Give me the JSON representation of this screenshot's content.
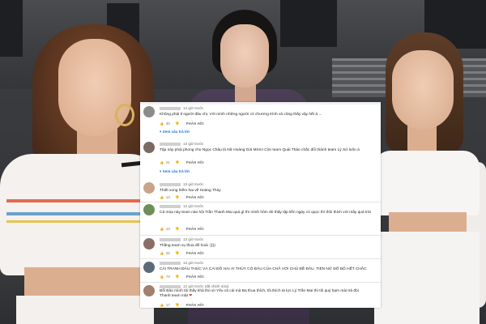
{
  "comments": [
    {
      "time": "14 giờ trước",
      "text": "Không phải tỉ người đâu chị. Với mình những người có chương trình và cũng thấy vậy hết á ...",
      "likes": "30",
      "reply_label": "PHẢN HỒI",
      "replies_link": "Xem câu trả lời"
    },
    {
      "time": "13 giờ trước",
      "text": "Tập này phải phong cho Ngọc Châu là Nữ Hoàng Giả Mờm! Còn team Quái Thảo chắc đổi thành team Lý Sứ luôn á",
      "likes": "21",
      "reply_label": "PHẢN HỒI",
      "replies_link": "Xem câu trả lời"
    },
    {
      "time": "13 giờ trước",
      "text": "Thiết xong hiếm hai về Hoàng Thùy",
      "likes": "13",
      "reply_label": "PHẢN HỒI"
    },
    {
      "time": "12 giờ trước",
      "text": "Cả mùa này team nào hội Trần Thanh Mai quá gì thì mình hôm đó thấy tập liền ngày có quọc thì thôi thích với mấy quá trời",
      "likes": "13",
      "reply_label": "PHẢN HỒI"
    },
    {
      "time": "13 giờ trước",
      "text": "Thằng team vụ thua đổ hoài :))))",
      "likes": "32",
      "reply_label": "PHẢN HỒI"
    },
    {
      "time": "13 giờ trước",
      "text": "CÁI TRANH ĐÂU THÚC VÀ CÁI ĐỒ HAI ÁI THỦY CÓ ĐÂU CỦA CHẤ VỚI CHỦ ĐỀ ĐÂU. TIÊN NỮ ĐỐ BỘ HẾT CHẮC",
      "likes": "74",
      "reply_label": "PHẢN HỒI"
    },
    {
      "time": "12 giờ trước (đã chỉnh sửa)",
      "text": "Bối Bảo mình tôi thấy khá thú vị! Yêu cả cái mà Ba thua thích, tôi thích tá lực Lý Trần Mai thì tôi quý hạm mài trả đòi",
      "text_extra": "Thanh team mặt",
      "likes": "17",
      "reply_label": "PHẢN HỒI"
    }
  ],
  "icons": {
    "like": "thumb-up-icon",
    "dislike": "thumb-down-icon",
    "expand": "chevron-down-icon"
  },
  "colors": {
    "link": "#1a73e8",
    "heart": "#e53935"
  }
}
